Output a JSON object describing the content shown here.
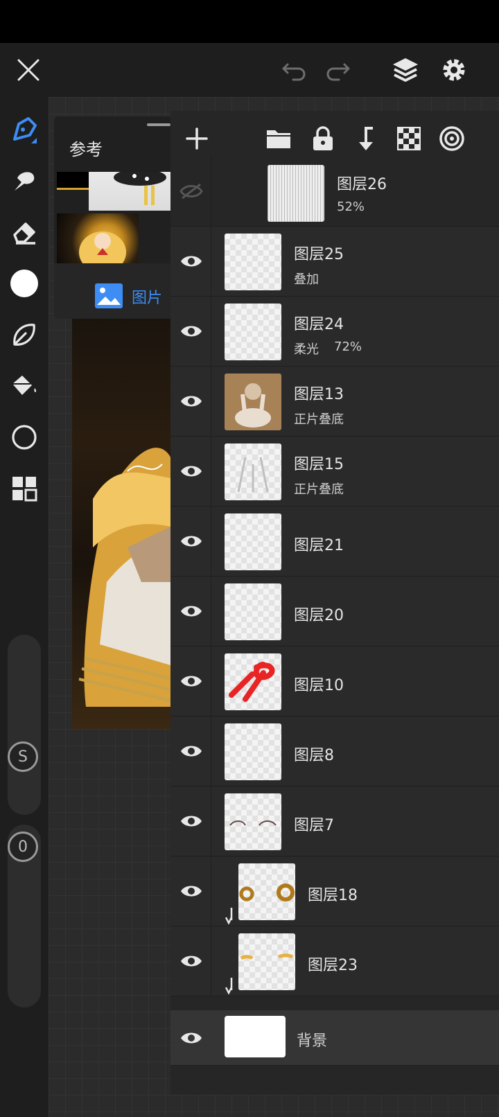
{
  "topbar": {
    "close_icon": "close-icon",
    "undo_icon": "undo-icon",
    "redo_icon": "redo-icon",
    "layers_icon": "layers-icon",
    "settings_icon": "gear-icon"
  },
  "tools": [
    "pen-icon",
    "smudge-icon",
    "eraser-icon",
    "color-swatch",
    "leaf-icon",
    "bucket-icon",
    "circle-shape-icon",
    "grid-icon"
  ],
  "sliders": {
    "size_label": "S",
    "opacity_label": "0"
  },
  "reference": {
    "title": "参考",
    "image_label": "图片"
  },
  "layers": [
    {
      "name": "图层26",
      "mode": "52%",
      "opacity": "",
      "hidden": true,
      "clipped": false
    },
    {
      "name": "图层25",
      "mode": "叠加",
      "opacity": "",
      "hidden": false,
      "clipped": false
    },
    {
      "name": "图层24",
      "mode": "柔光",
      "opacity": "72%",
      "hidden": false,
      "clipped": false
    },
    {
      "name": "图层13",
      "mode": "正片叠底",
      "opacity": "",
      "hidden": false,
      "clipped": false
    },
    {
      "name": "图层15",
      "mode": "正片叠底",
      "opacity": "",
      "hidden": false,
      "clipped": false
    },
    {
      "name": "图层21",
      "mode": "",
      "opacity": "",
      "hidden": false,
      "clipped": false
    },
    {
      "name": "图层20",
      "mode": "",
      "opacity": "",
      "hidden": false,
      "clipped": false
    },
    {
      "name": "图层10",
      "mode": "",
      "opacity": "",
      "hidden": false,
      "clipped": false
    },
    {
      "name": "图层8",
      "mode": "",
      "opacity": "",
      "hidden": false,
      "clipped": false
    },
    {
      "name": "图层7",
      "mode": "",
      "opacity": "",
      "hidden": false,
      "clipped": false
    },
    {
      "name": "图层18",
      "mode": "",
      "opacity": "",
      "hidden": false,
      "clipped": true
    },
    {
      "name": "图层23",
      "mode": "",
      "opacity": "",
      "hidden": false,
      "clipped": true
    },
    {
      "name": "背景",
      "mode": "",
      "opacity": "",
      "hidden": false,
      "clipped": false
    }
  ],
  "colors": {
    "accent": "#3d8df5",
    "panel": "#262626",
    "row": "#2a2a2a",
    "selected_row": "#353535"
  }
}
